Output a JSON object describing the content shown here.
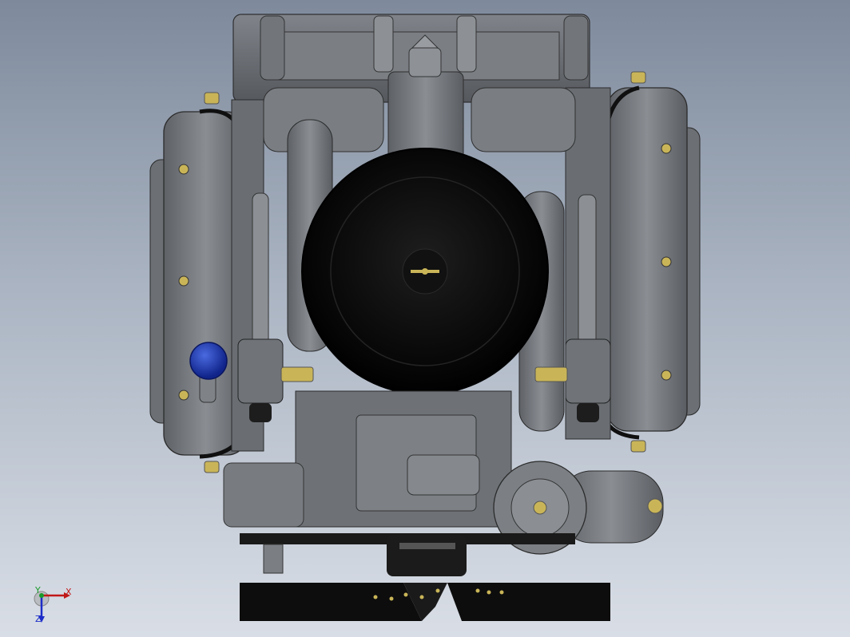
{
  "viewport": {
    "background_top": "#7e8a9c",
    "background_bottom": "#d9dee6",
    "model_body_color": "#6f7378",
    "model_dark_color": "#1a1a1a",
    "model_accent_color": "#c9b558",
    "model_cap_color": "#1f3fb0"
  },
  "triad": {
    "x_label": "X",
    "y_label": "Y",
    "z_label": "Z",
    "x_color": "#c01818",
    "y_color": "#1a9a2a",
    "z_color": "#1c2cc8"
  }
}
